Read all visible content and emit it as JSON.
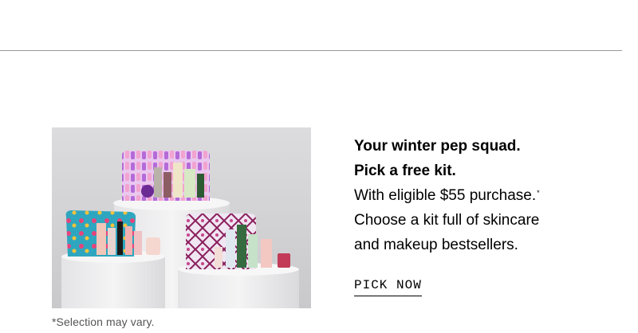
{
  "promo": {
    "headline_line1": "Your winter pep squad.",
    "headline_line2": "Pick a free kit.",
    "body_line1": "With eligible $55 purchase.",
    "body_line1_mark": "*",
    "body_line2": "Choose a kit full of skincare",
    "body_line3": "and makeup bestsellers.",
    "cta_label": "PICK NOW",
    "disclaimer": "*Selection may vary.",
    "image_alt": "Free gift kits with cosmetic bags, skincare and makeup products"
  },
  "colors": {
    "divider": "#9a9a9a",
    "text": "#000000",
    "disclaimer_text": "#555555",
    "image_background": "#d6d6d8"
  }
}
